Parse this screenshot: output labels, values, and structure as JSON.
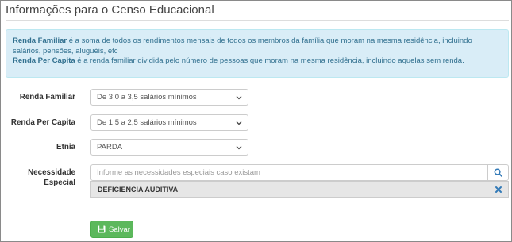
{
  "page": {
    "title": "Informações para o Censo Educacional"
  },
  "info": {
    "renda_familiar_term": "Renda Familiar",
    "renda_familiar_text": " é a soma de todos os rendimentos mensais de todos os membros da família que moram na mesma residência, incluindo salários, pensões, aluguéis, etc",
    "renda_per_capita_term": "Renda Per Capita",
    "renda_per_capita_text": " é a renda familiar dividida pelo número de pessoas que moram na mesma residência, incluindo aquelas sem renda."
  },
  "form": {
    "renda_familiar": {
      "label": "Renda Familiar",
      "value": "De 3,0 a 3,5 salários mínimos"
    },
    "renda_per_capita": {
      "label": "Renda Per Capita",
      "value": "De 1,5 a 2,5 salários mínimos"
    },
    "etnia": {
      "label": "Etnia",
      "value": "PARDA"
    },
    "necessidade": {
      "label_line1": "Necessidade",
      "label_line2": "Especial",
      "placeholder": "Informe as necessidades especiais caso existam",
      "selected": "DEFICIENCIA AUDITIVA"
    }
  },
  "actions": {
    "save_label": "Salvar"
  },
  "icons": {
    "search": "search-icon",
    "remove": "times-icon",
    "save": "floppy-disk-icon",
    "select": "chevron-down-icon"
  },
  "colors": {
    "info_bg": "#d9edf7",
    "info_text": "#31708f",
    "save_bg": "#5cb85c",
    "link_blue": "#337ab7"
  }
}
